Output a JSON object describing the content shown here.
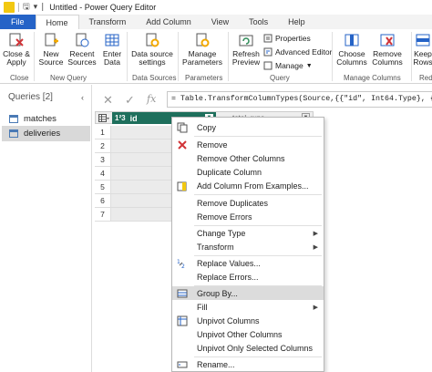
{
  "window": {
    "title": "Untitled - Power Query Editor"
  },
  "tabs": [
    "File",
    "Home",
    "Transform",
    "Add Column",
    "View",
    "Tools",
    "Help"
  ],
  "ribbon": {
    "close_apply": "Close &",
    "close_apply_2": "Apply",
    "new_source": "New",
    "new_source_2": "Source",
    "recent_sources": "Recent",
    "recent_sources_2": "Sources",
    "enter_data": "Enter",
    "enter_data_2": "Data",
    "data_source_settings": "Data source",
    "data_source_settings_2": "settings",
    "manage_parameters": "Manage",
    "manage_parameters_2": "Parameters",
    "refresh_preview": "Refresh",
    "refresh_preview_2": "Preview",
    "properties": "Properties",
    "advanced_editor": "Advanced Editor",
    "manage": "Manage",
    "choose_columns": "Choose",
    "choose_columns_2": "Columns",
    "remove_columns": "Remove",
    "remove_columns_2": "Columns",
    "keep_rows": "Keep",
    "keep_rows_2": "Rows",
    "groups": {
      "close": "Close",
      "new_query": "New Query",
      "data_sources": "Data Sources",
      "parameters": "Parameters",
      "query": "Query",
      "manage_columns": "Manage Columns",
      "reduce": "Red"
    }
  },
  "queries": {
    "header": "Queries [2]",
    "items": [
      "matches",
      "deliveries"
    ]
  },
  "formula_bar": {
    "text": "= Table.TransformColumnTypes(Source,{{\"id\", Int64.Type}, {\"total_"
  },
  "grid": {
    "column_type": "1²3",
    "column_name": "id",
    "second_column": "total_runs",
    "rows": [
      "1",
      "2",
      "3",
      "4",
      "5",
      "6",
      "7"
    ]
  },
  "context_menu": {
    "items": [
      "Copy",
      "Remove",
      "Remove Other Columns",
      "Duplicate Column",
      "Add Column From Examples...",
      "Remove Duplicates",
      "Remove Errors",
      "Change Type",
      "Transform",
      "Replace Values...",
      "Replace Errors...",
      "Group By...",
      "Fill",
      "Unpivot Columns",
      "Unpivot Other Columns",
      "Unpivot Only Selected Columns",
      "Rename..."
    ]
  },
  "colors": {
    "file_tab": "#2563c7",
    "column_header": "#1e6f5c",
    "highlight": "#dcdcdc"
  }
}
